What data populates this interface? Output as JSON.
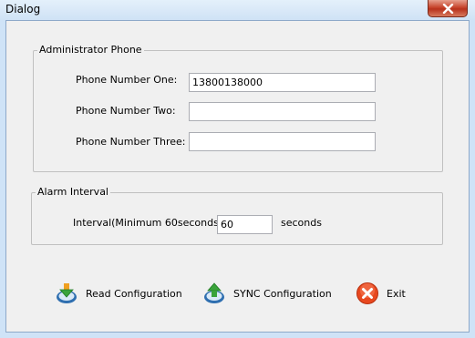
{
  "window": {
    "title": "Dialog"
  },
  "admin_phone": {
    "group_title": "Administrator Phone",
    "phone_one": {
      "label": "Phone Number One:",
      "value": "13800138000"
    },
    "phone_two": {
      "label": "Phone Number Two:",
      "value": ""
    },
    "phone_three": {
      "label": "Phone Number Three:",
      "value": ""
    }
  },
  "alarm": {
    "group_title": "Alarm Interval",
    "interval_label": "Interval(Minimum 60seconds):",
    "interval_value": "60",
    "unit": "seconds"
  },
  "buttons": {
    "read_label": "Read Configuration",
    "read_icon": "download-arrow-icon",
    "sync_label": "SYNC Configuration",
    "sync_icon": "upload-arrow-icon",
    "exit_label": "Exit",
    "exit_icon": "red-x-icon"
  },
  "colors": {
    "title_bar": "#cfe2f5",
    "close_button": "#c7452d",
    "dialog_background": "#f0f0f0",
    "exit_icon": "#e8481f",
    "arrow_icon": "#3aa33b"
  }
}
